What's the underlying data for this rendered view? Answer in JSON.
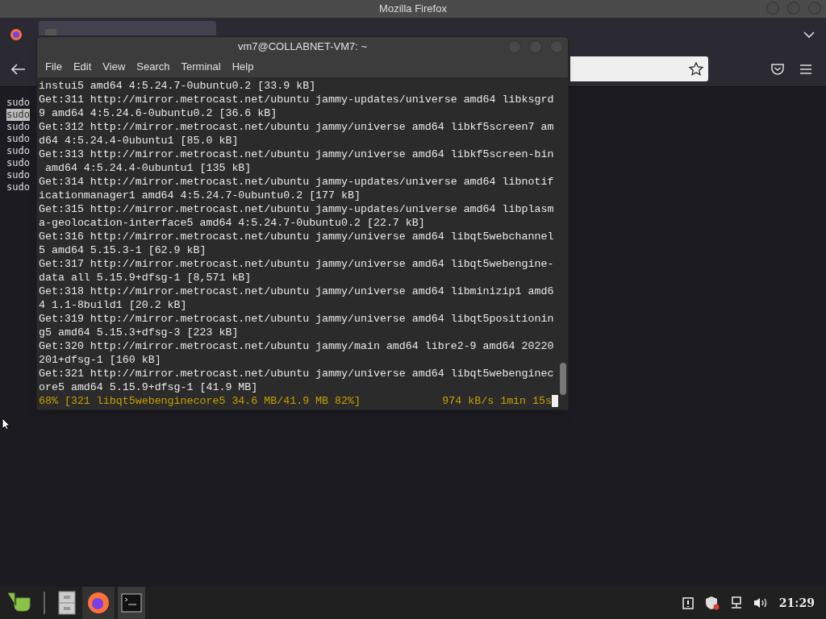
{
  "firefox": {
    "title": "Mozilla Firefox",
    "sudo_lines": [
      {
        "text": "sudo",
        "selected": false
      },
      {
        "text": "sudo",
        "selected": true
      },
      {
        "text": "sudo",
        "selected": false
      },
      {
        "text": "sudo",
        "selected": false
      },
      {
        "text": "sudo",
        "selected": false
      },
      {
        "text": "sudo",
        "selected": false
      },
      {
        "text": "sudo",
        "selected": false
      },
      {
        "text": "sudo",
        "selected": false
      }
    ]
  },
  "terminal": {
    "title": "vm7@COLLABNET-VM7: ~",
    "menu": [
      "File",
      "Edit",
      "View",
      "Search",
      "Terminal",
      "Help"
    ],
    "lines": [
      "instui5 amd64 4:5.24.7-0ubuntu0.2 [33.9 kB]",
      "Get:311 http://mirror.metrocast.net/ubuntu jammy-updates/universe amd64 libksgrd",
      "9 amd64 4:5.24.6-0ubuntu0.2 [36.6 kB]",
      "Get:312 http://mirror.metrocast.net/ubuntu jammy/universe amd64 libkf5screen7 am",
      "d64 4:5.24.4-0ubuntu1 [85.0 kB]",
      "Get:313 http://mirror.metrocast.net/ubuntu jammy/universe amd64 libkf5screen-bin",
      " amd64 4:5.24.4-0ubuntu1 [135 kB]",
      "Get:314 http://mirror.metrocast.net/ubuntu jammy-updates/universe amd64 libnotif",
      "icationmanager1 amd64 4:5.24.7-0ubuntu0.2 [177 kB]",
      "Get:315 http://mirror.metrocast.net/ubuntu jammy-updates/universe amd64 libplasm",
      "a-geolocation-interface5 amd64 4:5.24.7-0ubuntu0.2 [22.7 kB]",
      "Get:316 http://mirror.metrocast.net/ubuntu jammy/universe amd64 libqt5webchannel",
      "5 amd64 5.15.3-1 [62.9 kB]",
      "Get:317 http://mirror.metrocast.net/ubuntu jammy/universe amd64 libqt5webengine-",
      "data all 5.15.9+dfsg-1 [8,571 kB]",
      "Get:318 http://mirror.metrocast.net/ubuntu jammy/universe amd64 libminizip1 amd6",
      "4 1.1-8build1 [20.2 kB]",
      "Get:319 http://mirror.metrocast.net/ubuntu jammy/universe amd64 libqt5positionin",
      "g5 amd64 5.15.3+dfsg-3 [223 kB]",
      "Get:320 http://mirror.metrocast.net/ubuntu jammy/main amd64 libre2-9 amd64 20220",
      "201+dfsg-1 [160 kB]",
      "Get:321 http://mirror.metrocast.net/ubuntu jammy/universe amd64 libqt5webenginec",
      "ore5 amd64 5.15.9+dfsg-1 [41.9 MB]"
    ],
    "status_left": "68% [321 libqt5webenginecore5 34.6 MB/41.9 MB 82%]",
    "status_right": "974 kB/s 1min 15s"
  },
  "taskbar": {
    "clock": "21:29"
  }
}
